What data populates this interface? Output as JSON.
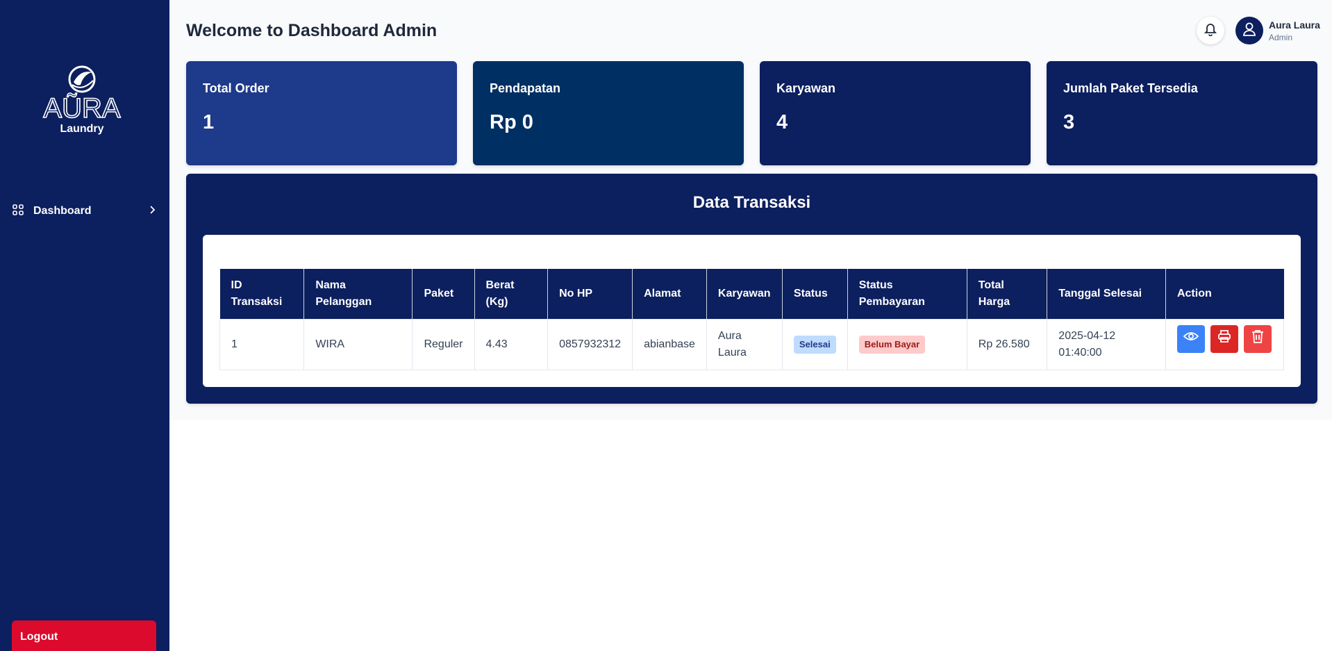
{
  "brand": {
    "name": "AŨRA",
    "sub": "Laundry"
  },
  "sidebar": {
    "items": [
      {
        "label": "Dashboard",
        "icon": "grid-icon"
      }
    ],
    "logout_label": "Logout"
  },
  "header": {
    "title": "Welcome to Dashboard Admin",
    "user_name": "Aura Laura",
    "user_role": "Admin"
  },
  "cards": [
    {
      "label": "Total Order",
      "value": "1"
    },
    {
      "label": "Pendapatan",
      "value": "Rp 0"
    },
    {
      "label": "Karyawan",
      "value": "4"
    },
    {
      "label": "Jumlah Paket Tersedia",
      "value": "3"
    }
  ],
  "transactions": {
    "title": "Data Transaksi",
    "columns": [
      "ID Transaksi",
      "Nama Pelanggan",
      "Paket",
      "Berat (Kg)",
      "No HP",
      "Alamat",
      "Karyawan",
      "Status",
      "Status Pembayaran",
      "Total Harga",
      "Tanggal Selesai",
      "Action"
    ],
    "rows": [
      {
        "id": "1",
        "nama": "WIRA",
        "paket": "Reguler",
        "berat": "4.43",
        "hp": "0857932312",
        "alamat": "abianbase",
        "karyawan": "Aura Laura",
        "status": "Selesai",
        "pembayaran": "Belum Bayar",
        "total": "Rp 26.580",
        "tanggal": "2025-04-12 01:40:00"
      }
    ]
  },
  "colors": {
    "sidebar": "#0c1f5e",
    "card_1": "#1e3a8a",
    "card_2": "#002f63",
    "logout": "#dc0a2d",
    "view_button": "#3b82f6",
    "print_button": "#dc2626",
    "delete_button": "#ef4444"
  }
}
